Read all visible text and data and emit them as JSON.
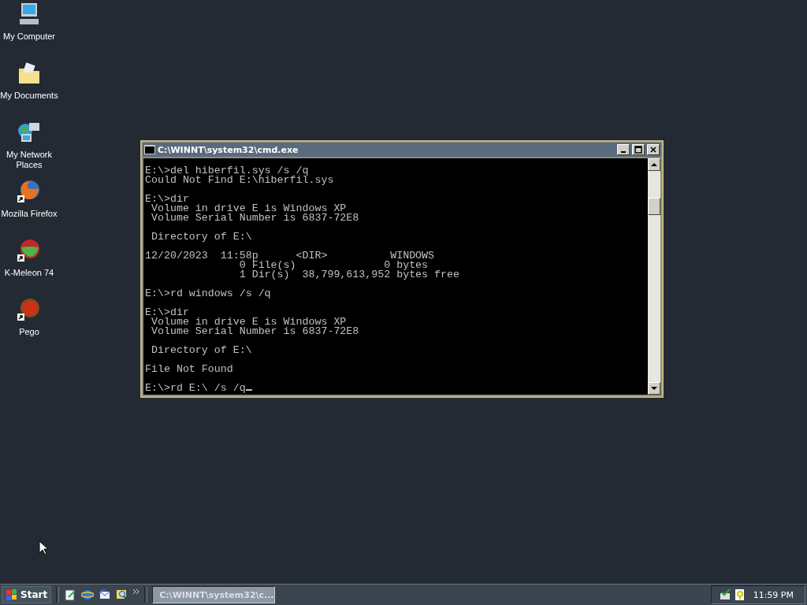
{
  "desktop_icons": [
    {
      "label": "My Computer",
      "kind": "computer",
      "shortcut": false
    },
    {
      "label": "My Documents",
      "kind": "folder",
      "shortcut": false
    },
    {
      "label": "My Network Places",
      "kind": "network",
      "shortcut": false
    },
    {
      "label": "Mozilla Firefox",
      "kind": "globe",
      "shortcut": true
    },
    {
      "label": "K-Meleon 74",
      "kind": "chameleon",
      "shortcut": true
    },
    {
      "label": "Pego",
      "kind": "ball",
      "shortcut": true
    }
  ],
  "window": {
    "title": "C:\\WINNT\\system32\\cmd.exe",
    "cursor": true,
    "blocks": [
      [
        "E:\\>del hiberfil.sys /s /q",
        "Could Not Find E:\\hiberfil.sys"
      ],
      [
        "E:\\>dir",
        " Volume in drive E is Windows XP",
        " Volume Serial Number is 6837-72E8"
      ],
      [
        " Directory of E:\\"
      ],
      [
        "12/20/2023  11:58p      <DIR>          WINDOWS",
        "               0 File(s)              0 bytes",
        "               1 Dir(s)  38,799,613,952 bytes free"
      ],
      [
        "E:\\>rd windows /s /q"
      ],
      [
        "E:\\>dir",
        " Volume in drive E is Windows XP",
        " Volume Serial Number is 6837-72E8"
      ],
      [
        " Directory of E:\\"
      ],
      [
        "File Not Found"
      ],
      [
        "E:\\>rd E:\\ /s /q"
      ]
    ]
  },
  "taskbar": {
    "start": "Start",
    "quick_launch": [
      {
        "kind": "notepad"
      },
      {
        "kind": "browser"
      },
      {
        "kind": "mail"
      },
      {
        "kind": "search"
      }
    ],
    "tasks": [
      {
        "label": "C:\\WINNT\\system32\\c...",
        "selected": true
      }
    ],
    "clock": "11:59 PM"
  }
}
